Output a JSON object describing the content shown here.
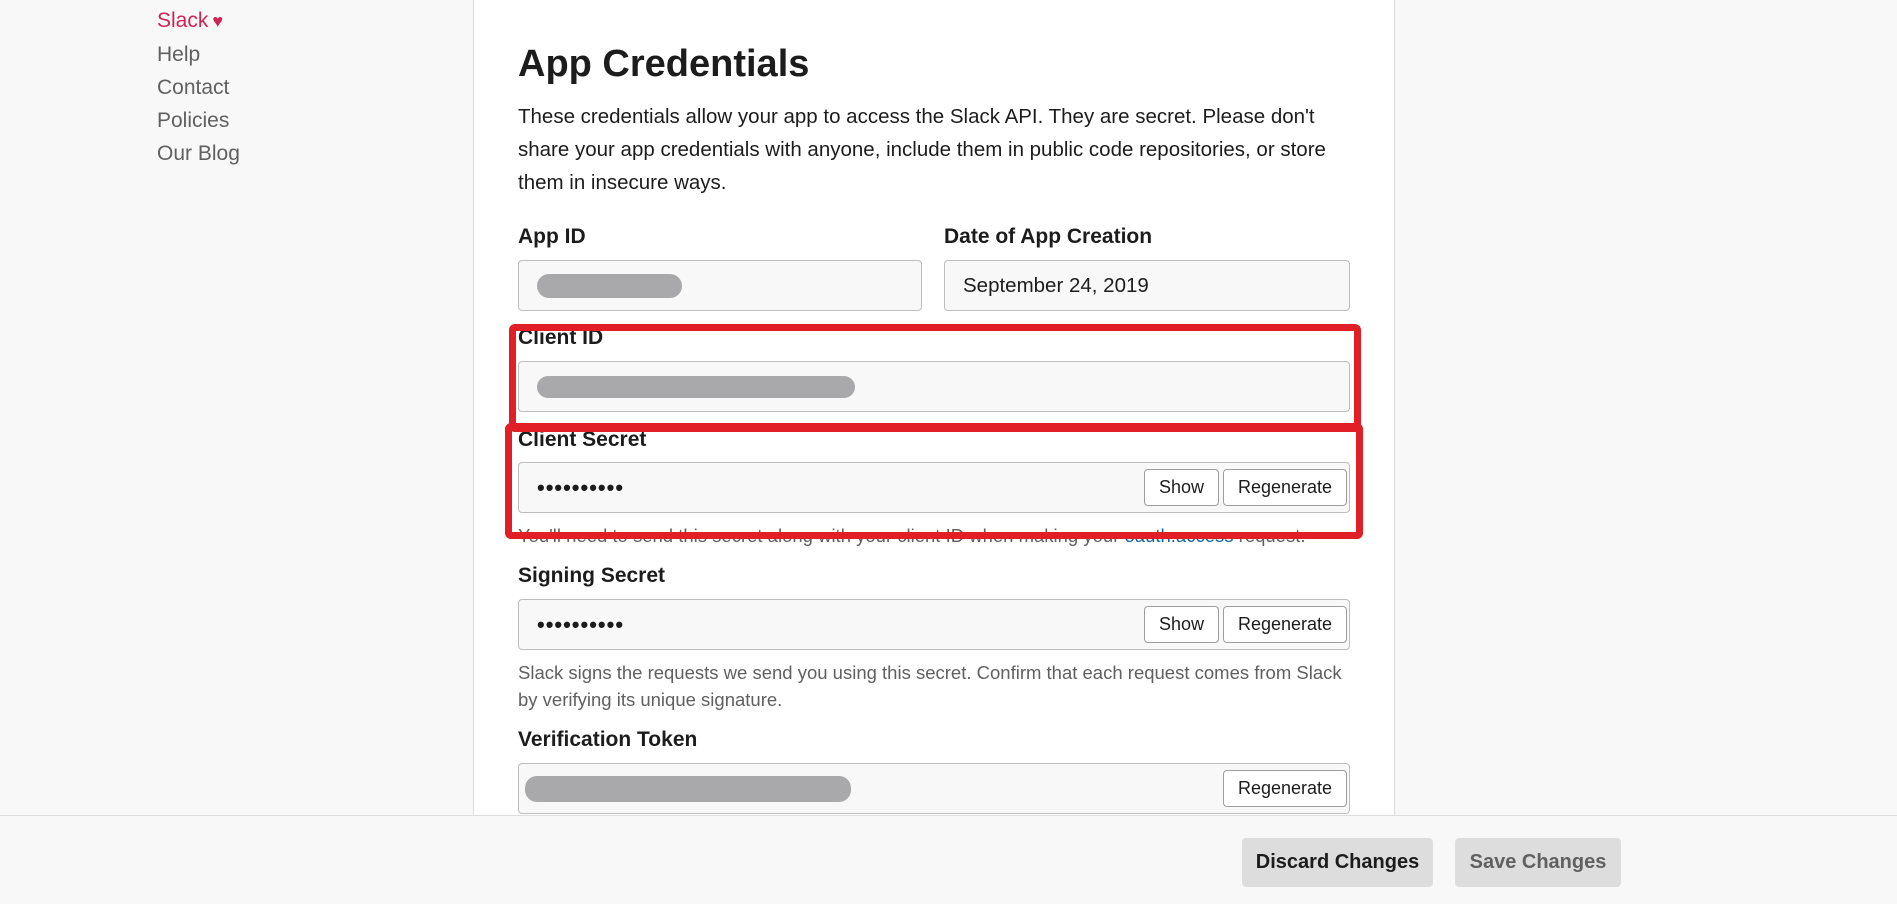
{
  "nav": {
    "items": [
      {
        "label": "Slack",
        "brand": true
      },
      {
        "label": "Help"
      },
      {
        "label": "Contact"
      },
      {
        "label": "Policies"
      },
      {
        "label": "Our Blog"
      }
    ],
    "heart": "♥"
  },
  "credentials": {
    "title": "App Credentials",
    "intro": "These credentials allow your app to access the Slack API. They are secret. Please don't share your app credentials with anyone, include them in public code repositories, or store them in insecure ways.",
    "app_id": {
      "label": "App ID",
      "value": ""
    },
    "date_created": {
      "label": "Date of App Creation",
      "value": "September 24, 2019"
    },
    "client_id": {
      "label": "Client ID",
      "value": ""
    },
    "client_secret": {
      "label": "Client Secret",
      "value": "••••••••••",
      "show_label": "Show",
      "regenerate_label": "Regenerate",
      "help_before": "You'll need to send this secret along with your client ID when making your ",
      "help_link": "oauth.access",
      "help_after": " request."
    },
    "signing_secret": {
      "label": "Signing Secret",
      "value": "••••••••••",
      "show_label": "Show",
      "regenerate_label": "Regenerate",
      "help": "Slack signs the requests we send you using this secret. Confirm that each request comes from Slack by verifying its unique signature."
    },
    "verification_token": {
      "label": "Verification Token",
      "regenerate_label": "Regenerate"
    }
  },
  "footer": {
    "discard_label": "Discard Changes",
    "save_label": "Save Changes"
  },
  "colors": {
    "brand": "#cd2553",
    "link": "#1264a3",
    "highlight": "#e01f26"
  }
}
